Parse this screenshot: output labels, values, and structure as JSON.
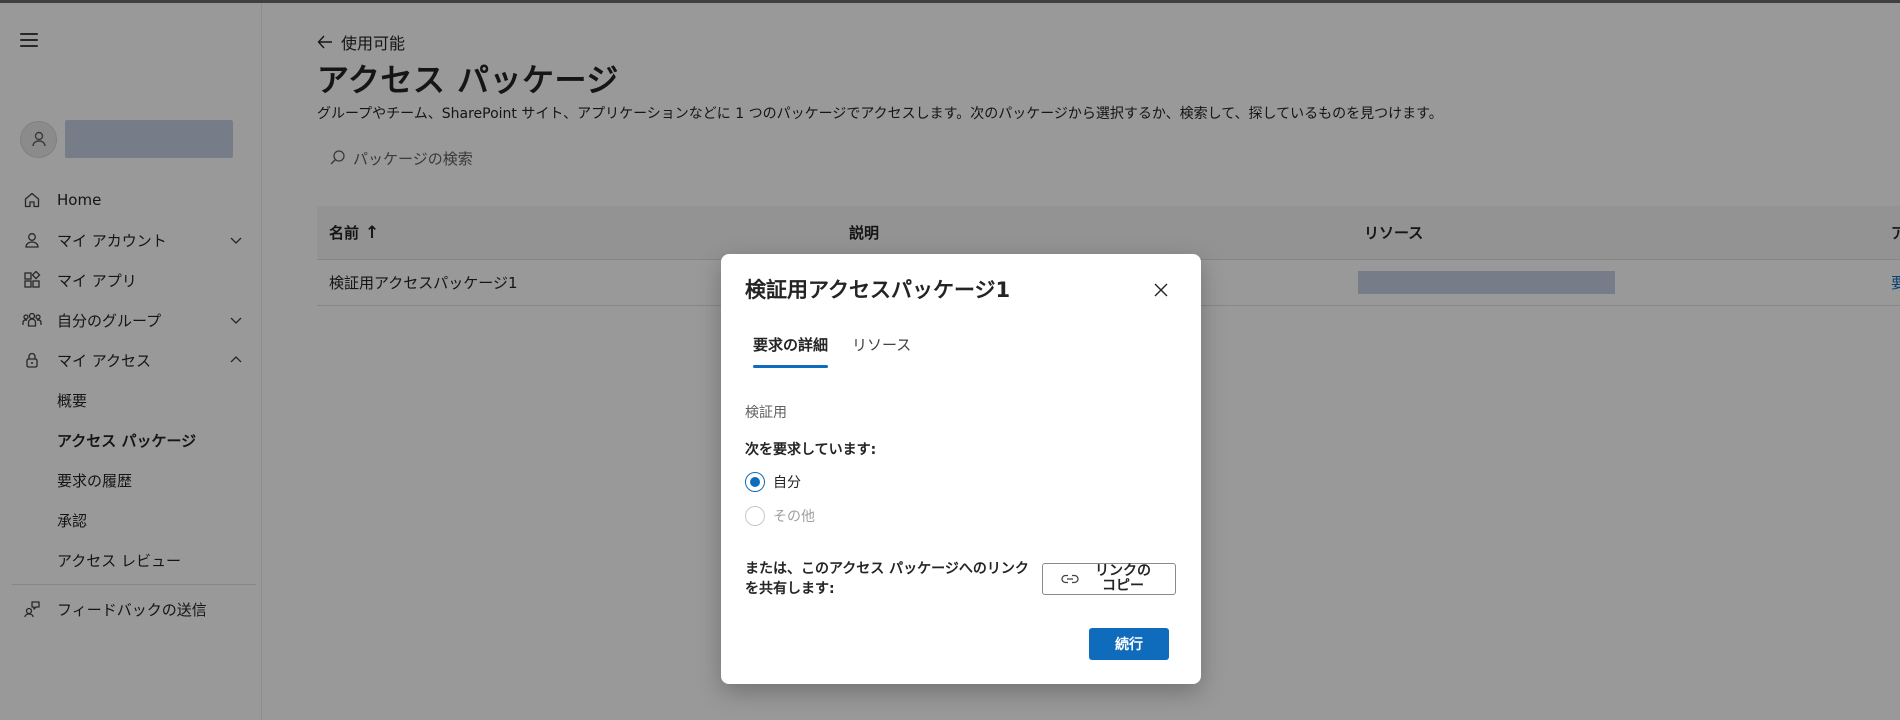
{
  "sidebar": {
    "items": [
      {
        "label": "Home",
        "icon": "home-icon"
      },
      {
        "label": "マイ アカウント",
        "icon": "person-icon",
        "expandable": true
      },
      {
        "label": "マイ アプリ",
        "icon": "apps-icon"
      },
      {
        "label": "自分のグループ",
        "icon": "people-group-icon",
        "expandable": true
      },
      {
        "label": "マイ アクセス",
        "icon": "lock-icon",
        "expanded": true
      }
    ],
    "sub_items": [
      "概要",
      "アクセス パッケージ",
      "要求の履歴",
      "承認",
      "アクセス レビュー"
    ],
    "active_sub": "アクセス パッケージ",
    "feedback": "フィードバックの送信"
  },
  "main": {
    "back_label": "使用可能",
    "title": "アクセス パッケージ",
    "description": "グループやチーム、SharePoint サイト、アプリケーションなどに 1 つのパッケージでアクセスします。次のパッケージから選択するか、検索して、探しているものを見つけます。",
    "search_placeholder": "パッケージの検索",
    "table": {
      "headers": {
        "name": "名前",
        "sort_arrow": "↑",
        "description": "説明",
        "resources": "リソース",
        "action": "ア"
      },
      "rows": [
        {
          "name": "検証用アクセスパッケージ1",
          "action": "要"
        }
      ]
    }
  },
  "dialog": {
    "title": "検証用アクセスパッケージ1",
    "tabs": [
      "要求の詳細",
      "リソース"
    ],
    "active_tab": "要求の詳細",
    "description": "検証用",
    "request_label": "次を要求しています:",
    "options": [
      {
        "label": "自分",
        "checked": true,
        "disabled": false
      },
      {
        "label": "その他",
        "checked": false,
        "disabled": true
      }
    ],
    "share_text": "または、このアクセス パッケージへのリンクを共有します:",
    "copy_link_label": "リンクの コピー",
    "continue_label": "続行"
  },
  "colors": {
    "accent": "#0f6cbd",
    "overlay": "rgba(0,0,0,0.40)",
    "redacted": "#c7d0e3"
  }
}
